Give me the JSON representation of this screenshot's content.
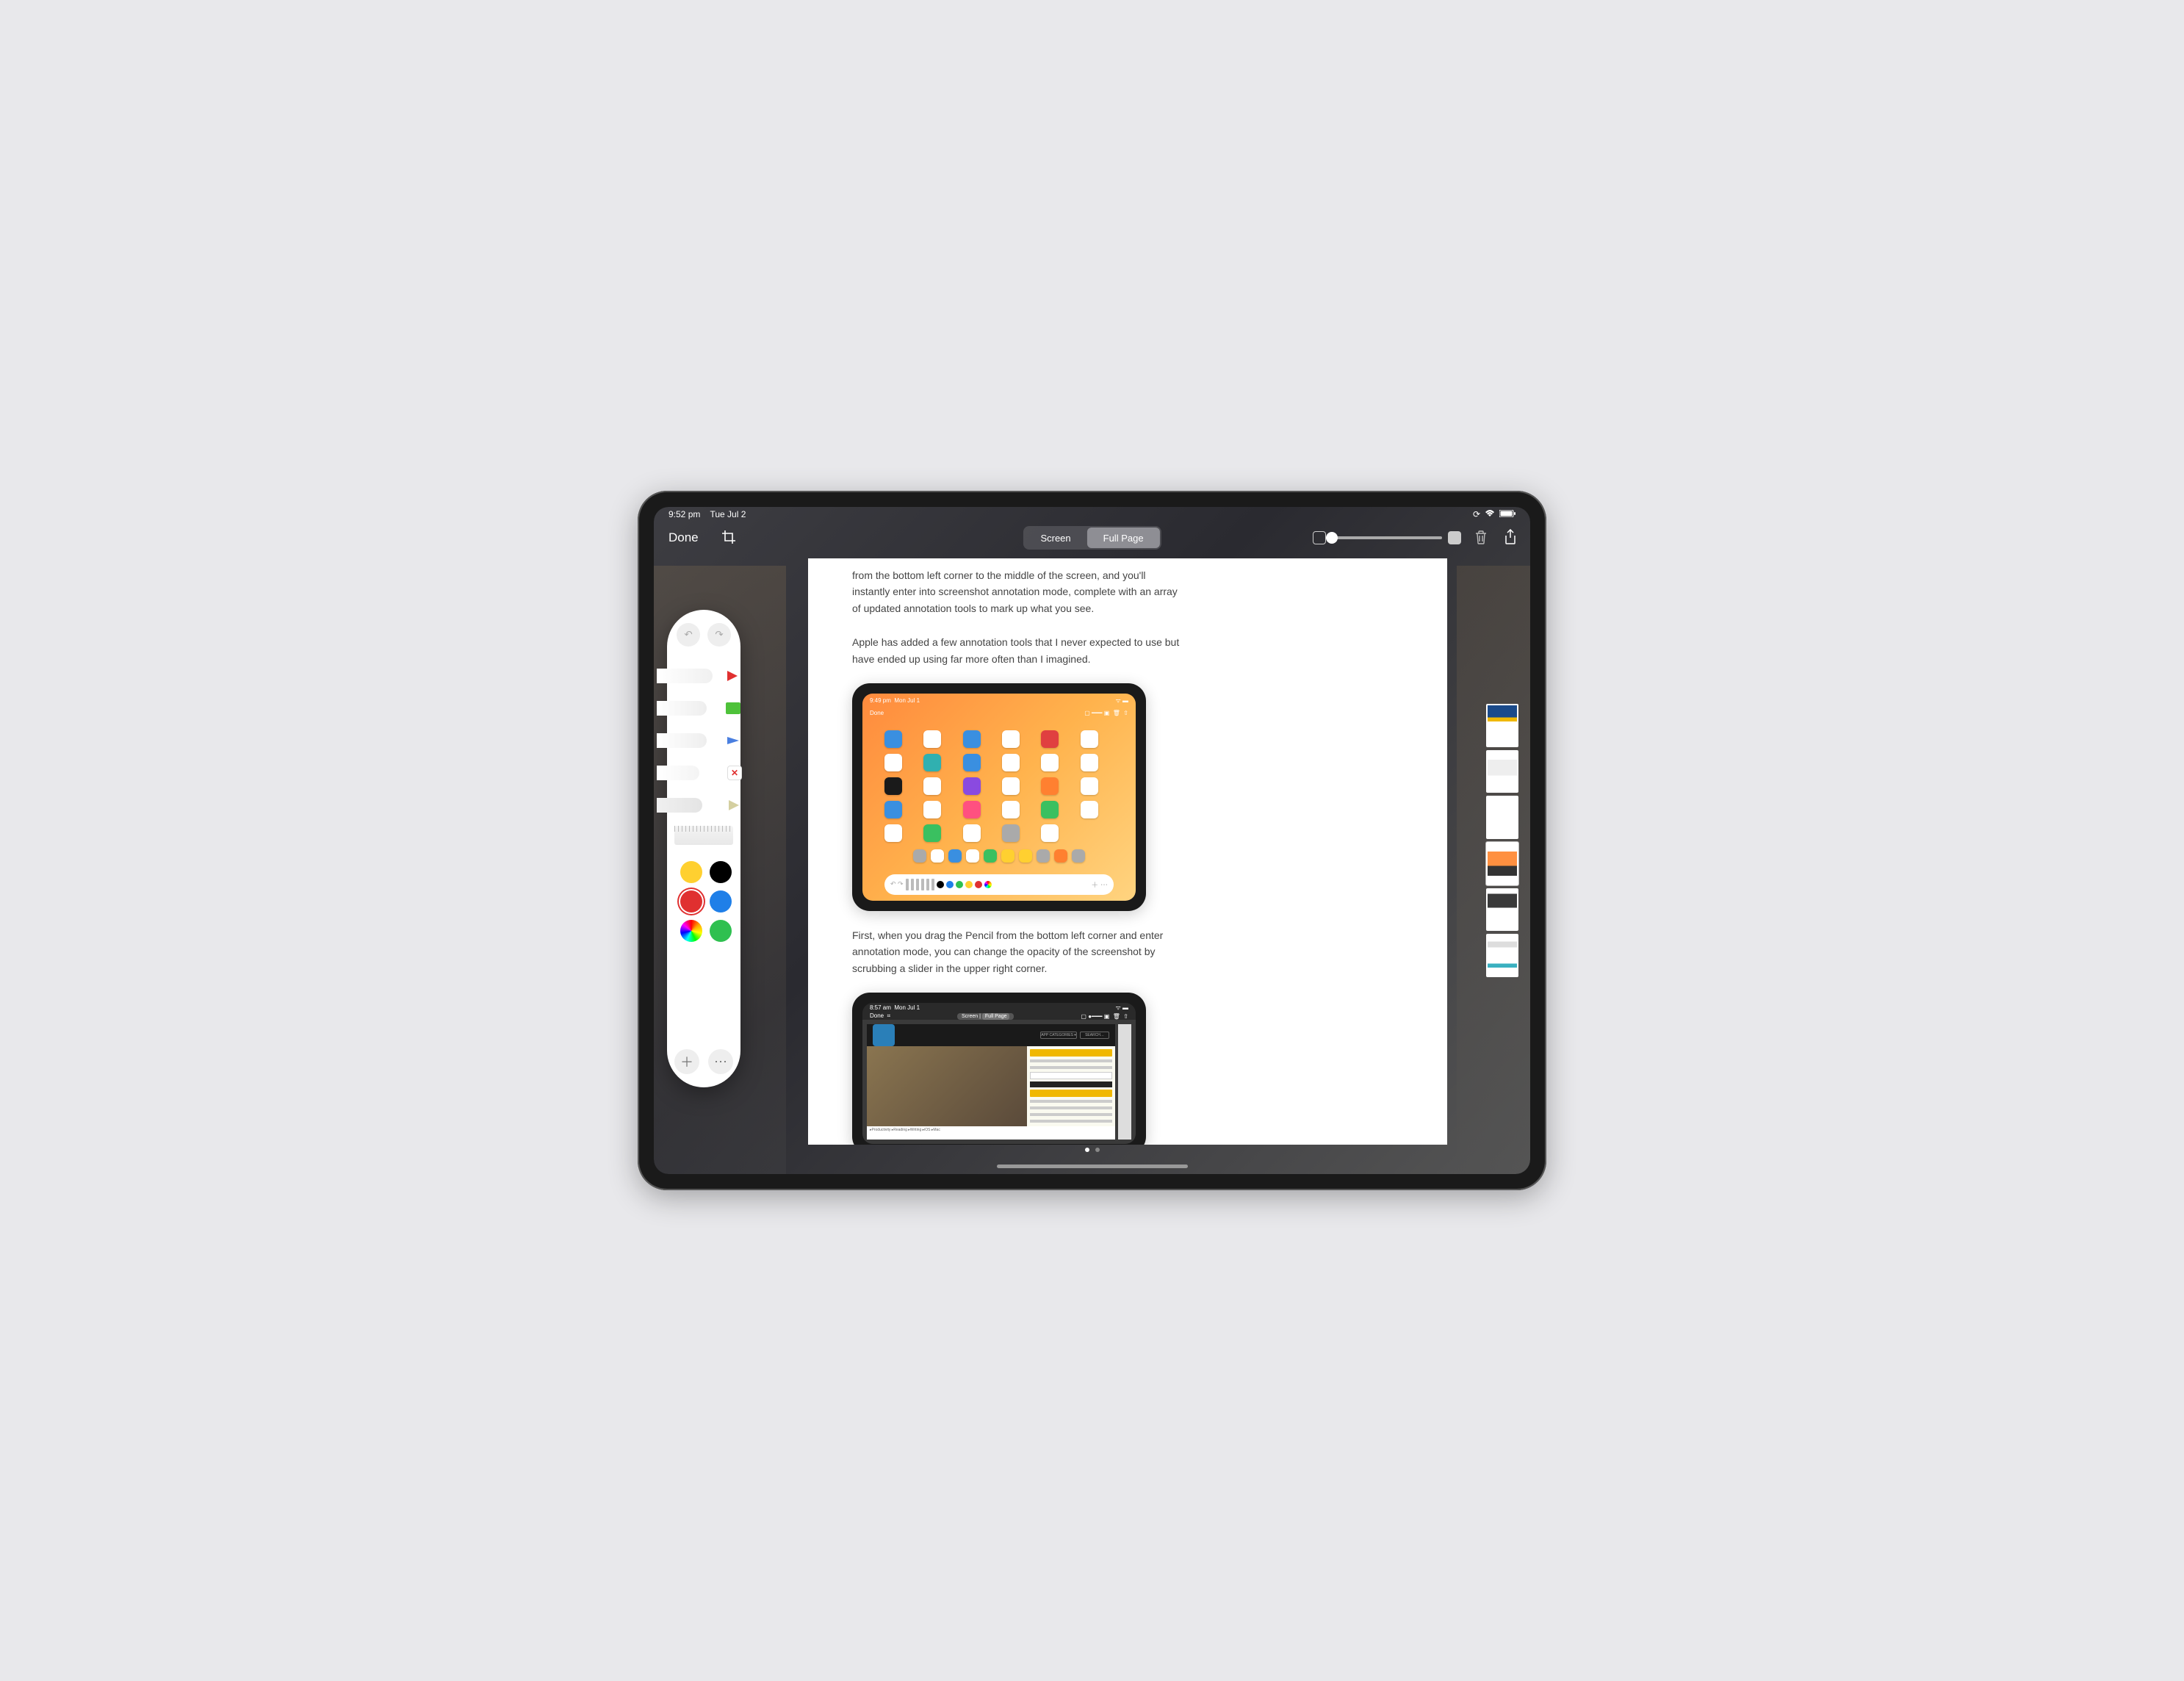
{
  "status": {
    "time": "9:52 pm",
    "date": "Tue Jul 2"
  },
  "topbar": {
    "done": "Done",
    "segments": {
      "screen": "Screen",
      "fullpage": "Full Page"
    },
    "active_segment": "fullpage"
  },
  "article": {
    "para1": "from the bottom left corner to the middle of the screen, and you'll instantly enter into screenshot annotation mode, complete with an array of updated annotation tools to mark up what you see.",
    "para2": "Apple has added a few annotation tools that I never expected to use but have ended up using far more often than I imagined.",
    "para3": "First, when you drag the Pencil from the bottom left corner and enter annotation mode, you can change the opacity of the screenshot by scrubbing a slider in the upper right corner.",
    "embed1": {
      "time": "9:49 pm",
      "date": "Mon Jul 1",
      "done": "Done"
    },
    "embed2": {
      "time": "8:57 am",
      "date": "Mon Jul 1",
      "done": "Done",
      "seg_screen": "Screen",
      "seg_fullpage": "Full Page"
    }
  },
  "palette": {
    "tools": [
      "pen",
      "highlighter",
      "pencil",
      "eraser",
      "lasso",
      "ruler"
    ],
    "colors": [
      {
        "name": "yellow",
        "hex": "#ffd030"
      },
      {
        "name": "black",
        "hex": "#000000"
      },
      {
        "name": "red",
        "hex": "#e03030",
        "selected": true
      },
      {
        "name": "blue",
        "hex": "#1f7fe8"
      },
      {
        "name": "rainbow",
        "hex": "rainbow"
      },
      {
        "name": "green",
        "hex": "#2fc050"
      }
    ],
    "eraser_mark": "✕"
  },
  "thumbnails": {
    "count": 6,
    "selected_index": 3
  },
  "opacity_slider": {
    "value": 0
  },
  "page_indicator": {
    "current": 1,
    "total": 2
  }
}
